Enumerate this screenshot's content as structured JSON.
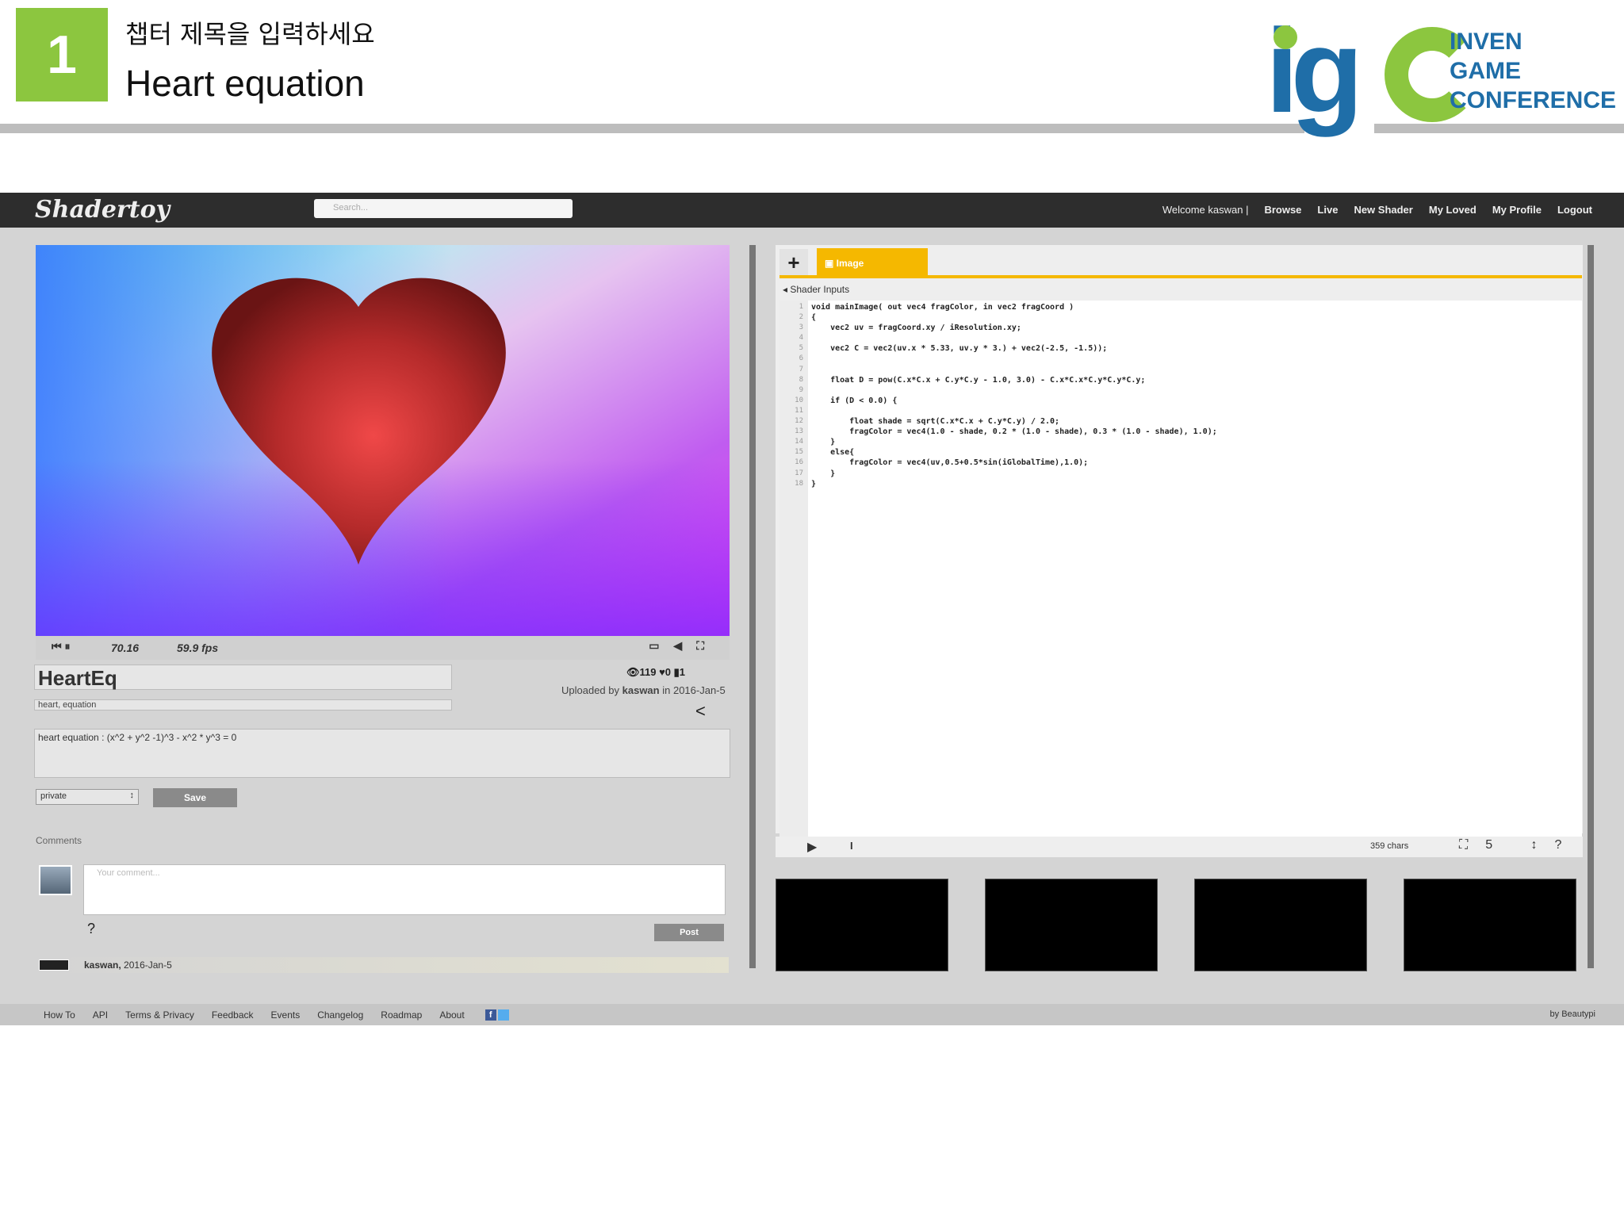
{
  "slide": {
    "number": "1",
    "chapter_sub": "챕터 제목을 입력하세요",
    "chapter_title": "Heart equation",
    "logo_letters": "igc",
    "logo_words": [
      "INVEN",
      "GAME",
      "CONFERENCE"
    ]
  },
  "app": {
    "brand": "Shadertoy",
    "search_placeholder": "Search...",
    "nav": {
      "welcome": "Welcome kaswan |",
      "items": [
        "Browse",
        "Live",
        "New Shader",
        "My Loved",
        "My Profile",
        "Logout"
      ]
    }
  },
  "player": {
    "time": "70.16",
    "fps": "59.9 fps"
  },
  "shader": {
    "title": "HeartEq",
    "tags": "heart, equation",
    "stats": "👁119  ♥0  ▮1",
    "uploaded_by_label": "Uploaded by",
    "uploaded_user": "kaswan",
    "uploaded_date": "in 2016-Jan-5",
    "description": "heart equation : (x^2 + y^2 -1)^3 - x^2 * y^3 = 0",
    "privacy": "private",
    "save_label": "Save"
  },
  "comments": {
    "label": "Comments",
    "placeholder": "Your comment...",
    "help": "?",
    "post_label": "Post",
    "entry_user": "kaswan,",
    "entry_date": "2016-Jan-5"
  },
  "editor": {
    "add_tab": "+",
    "tab_label": "Image",
    "shader_inputs": "Shader Inputs",
    "line_numbers": [
      "1",
      "2",
      "3",
      "4",
      "5",
      "6",
      "7",
      "8",
      "9",
      "10",
      "11",
      "12",
      "13",
      "14",
      "15",
      "16",
      "17",
      "18"
    ],
    "code": "void mainImage( out vec4 fragColor, in vec2 fragCoord )\n{\n    vec2 uv = fragCoord.xy / iResolution.xy;\n\n    vec2 C = vec2(uv.x * 5.33, uv.y * 3.) + vec2(-2.5, -1.5));\n\n\n    float D = pow(C.x*C.x + C.y*C.y - 1.0, 3.0) - C.x*C.x*C.y*C.y*C.y;\n\n    if (D < 0.0) {\n\n        float shade = sqrt(C.x*C.x + C.y*C.y) / 2.0;\n        fragColor = vec4(1.0 - shade, 0.2 * (1.0 - shade), 0.3 * (1.0 - shade), 1.0);\n    }\n    else{\n        fragColor = vec4(uv,0.5+0.5*sin(iGlobalTime),1.0);\n    }\n}",
    "chars": "359 chars",
    "font_size": "5 ↕",
    "help": "?"
  },
  "footer": {
    "links": [
      "How To",
      "API",
      "Terms & Privacy",
      "Feedback",
      "Events",
      "Changelog",
      "Roadmap",
      "About"
    ],
    "by": "by Beautypi"
  },
  "colors": {
    "accent_green": "#8cc63f",
    "logo_blue": "#1f6ea8",
    "tab_yellow": "#f5b800"
  }
}
